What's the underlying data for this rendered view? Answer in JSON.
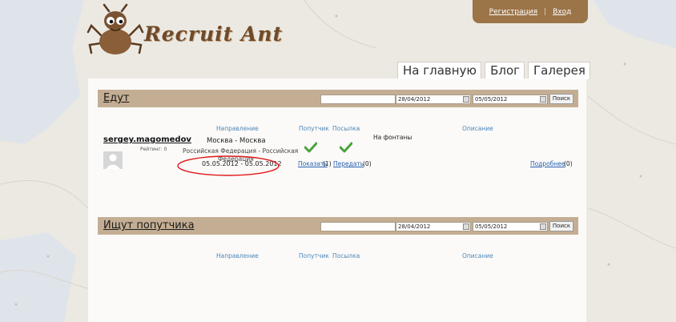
{
  "header": {
    "register_label": "Регистрация",
    "separator": "|",
    "login_label": "Вход",
    "logo_text": "Recruit Ant"
  },
  "nav": {
    "tabs": [
      "На главную",
      "Блог",
      "Галерея"
    ]
  },
  "section_going": {
    "title": "Едут",
    "date_from": "28/04/2012",
    "date_to": "05/05/2012",
    "search_label": "Поиск",
    "columns": {
      "direction": "Направление",
      "companion": "Попутчик",
      "parcel": "Посылка",
      "description": "Описание"
    },
    "entry": {
      "username": "sergey.magomedov",
      "rating": "Рейтинг: 0",
      "route": "Москва - Москва",
      "country_line1": "Российская Федерация - Российская",
      "country_line2": "Федерация",
      "dates": "05.05.2012 - 05.05.2012",
      "note": "На фонтаны",
      "show_link": "Показать",
      "show_count": "(1)",
      "send_link": "Передать",
      "send_count": "(0)",
      "more_link": "Подробнее",
      "more_count": "(0)"
    }
  },
  "section_seeking": {
    "title": "Ищут попутчика",
    "date_from": "28/04/2012",
    "date_to": "05/05/2012",
    "search_label": "Поиск",
    "columns": {
      "direction": "Направление",
      "companion": "Попутчик",
      "parcel": "Посылка",
      "description": "Описание"
    }
  },
  "colors": {
    "topbar": "#9b7448",
    "section_header": "#c4ae93",
    "link": "#2962b0",
    "check": "#4aa33a",
    "highlight_oval": "#e01818"
  }
}
